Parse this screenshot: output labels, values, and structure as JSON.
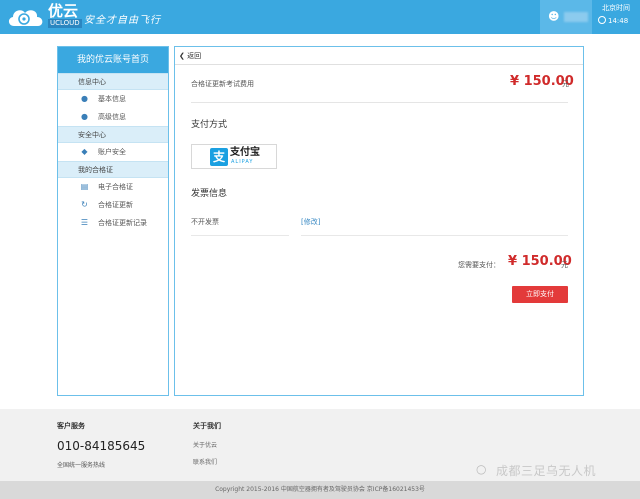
{
  "header": {
    "logo_text": "优云",
    "logo_sub": "UCLOUD",
    "slogan": "安全才自由飞行",
    "user_icon": "user-icon",
    "right_label": "北京时间",
    "time": "14:48"
  },
  "sidebar": {
    "title": "我的优云账号首页",
    "sections": [
      {
        "title": "信息中心",
        "items": [
          {
            "label": "基本信息",
            "icon": "person-icon"
          },
          {
            "label": "高级信息",
            "icon": "person-plus-icon"
          }
        ]
      },
      {
        "title": "安全中心",
        "items": [
          {
            "label": "账户安全",
            "icon": "shield-icon"
          }
        ]
      },
      {
        "title": "我的合格证",
        "items": [
          {
            "label": "电子合格证",
            "icon": "card-icon"
          },
          {
            "label": "合格证更新",
            "icon": "refresh-icon"
          },
          {
            "label": "合格证更新记录",
            "icon": "list-icon"
          }
        ]
      }
    ]
  },
  "main": {
    "back_label": "返回",
    "fee_label": "合格证更新考试费用",
    "fee_amount": "¥ 150.00",
    "fee_unit": "元",
    "payment_title": "支付方式",
    "alipay_logo_text": "支付宝",
    "alipay_logo_sub": "ALIPAY",
    "invoice_title": "发票信息",
    "invoice_value": "不开发票",
    "invoice_link": "[修改]",
    "total_label": "您需要支付：",
    "total_amount": "¥ 150.00",
    "total_unit": "元",
    "pay_button": "立即支付"
  },
  "footer": {
    "cs_title": "客户服务",
    "cs_phone": "010-84185645",
    "cs_sub": "全国统一服务热线",
    "about_title": "关于我们",
    "about_links": [
      "关于优云",
      "联系我们"
    ],
    "watermark": "成都三足乌无人机",
    "copyright": "Copyright 2015-2016 中国航空器拥有者及驾驶员协会 京ICP备16021453号"
  },
  "colors": {
    "brand_blue": "#3aa8e0",
    "price_red": "#d02b2b",
    "button_red": "#e33a3a",
    "alipay_blue": "#1ba0e1"
  }
}
